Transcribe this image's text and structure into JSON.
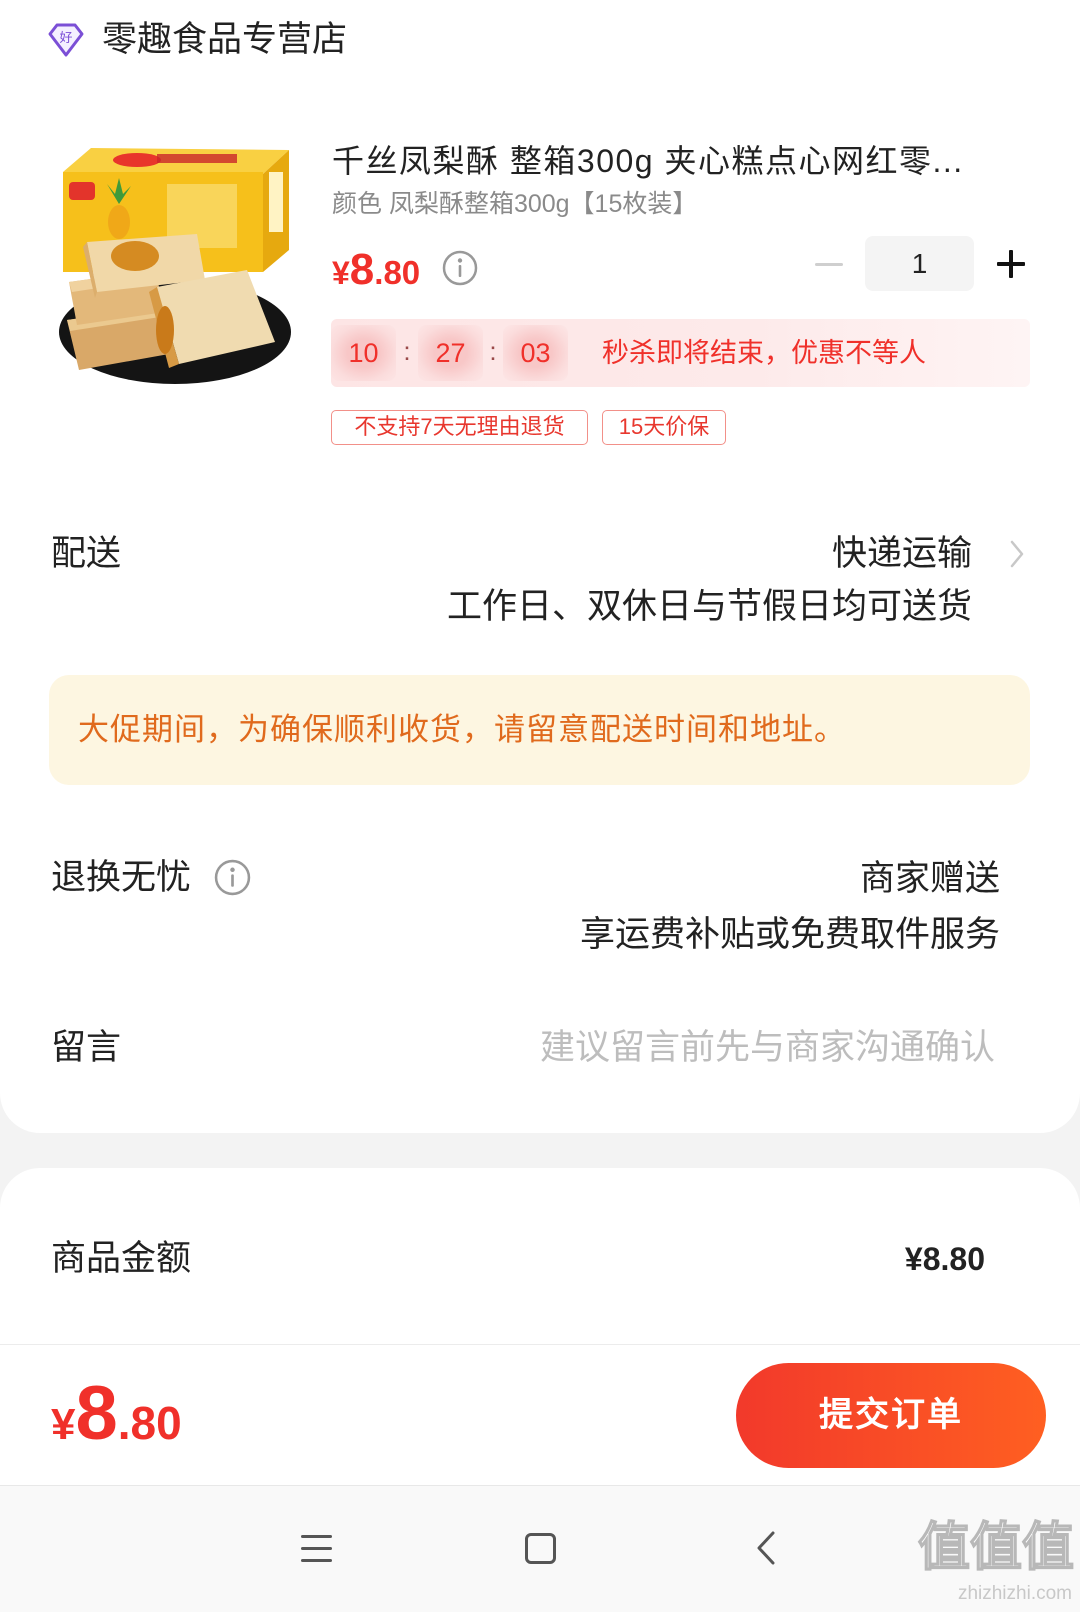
{
  "store": {
    "name": "零趣食品专营店",
    "badge_char": "好",
    "icon": "store-badge-icon"
  },
  "product": {
    "image": "pineapple-cake-box-photo",
    "title": "千丝凤梨酥 整箱300g 夹心糕点心网红零...",
    "spec": "颜色 凤梨酥整箱300g【15枚装】",
    "price": {
      "currency": "¥",
      "integer": "8",
      "decimal": ".80"
    },
    "price_info_icon": "info-icon",
    "quantity": "1",
    "minus_icon": "minus-icon",
    "plus_icon": "plus-icon",
    "flash_sale": {
      "hours": "10",
      "minutes": "27",
      "seconds": "03",
      "separator": ":",
      "message": "秒杀即将结束，优惠不等人"
    },
    "tags": [
      "不支持7天无理由退货",
      "15天价保"
    ]
  },
  "delivery": {
    "label": "配送",
    "method": "快递运输",
    "schedule": "工作日、双休日与节假日均可送货",
    "chevron_icon": "chevron-right-icon"
  },
  "notice": {
    "text": "大促期间，为确保顺利收货，请留意配送时间和地址。"
  },
  "returns": {
    "label": "退换无忧",
    "info_icon": "info-icon",
    "value": "商家赠送",
    "detail": "享运费补贴或免费取件服务"
  },
  "message": {
    "label": "留言",
    "placeholder": "建议留言前先与商家沟通确认"
  },
  "summary": {
    "goods_amount_label": "商品金额",
    "goods_amount": "¥8.80"
  },
  "footer": {
    "total": {
      "currency": "¥",
      "integer": "8",
      "decimal": ".80"
    },
    "submit_label": "提交订单"
  },
  "system_nav": {
    "menu_icon": "menu-icon",
    "home_icon": "home-square-icon",
    "back_icon": "back-chevron-icon"
  },
  "watermark": {
    "logo_text": "值值值",
    "url": "zhizhizhi.com"
  },
  "colors": {
    "accent_red": "#f0302a",
    "submit_gradient_start": "#f2392b",
    "submit_gradient_end": "#ff5f21",
    "notice_background": "#fdf6e1",
    "notice_text": "#e06a1d",
    "store_badge": "#7b4fd6",
    "flash_sale_background": "#fde5e5",
    "tag_border": "#f29089"
  }
}
